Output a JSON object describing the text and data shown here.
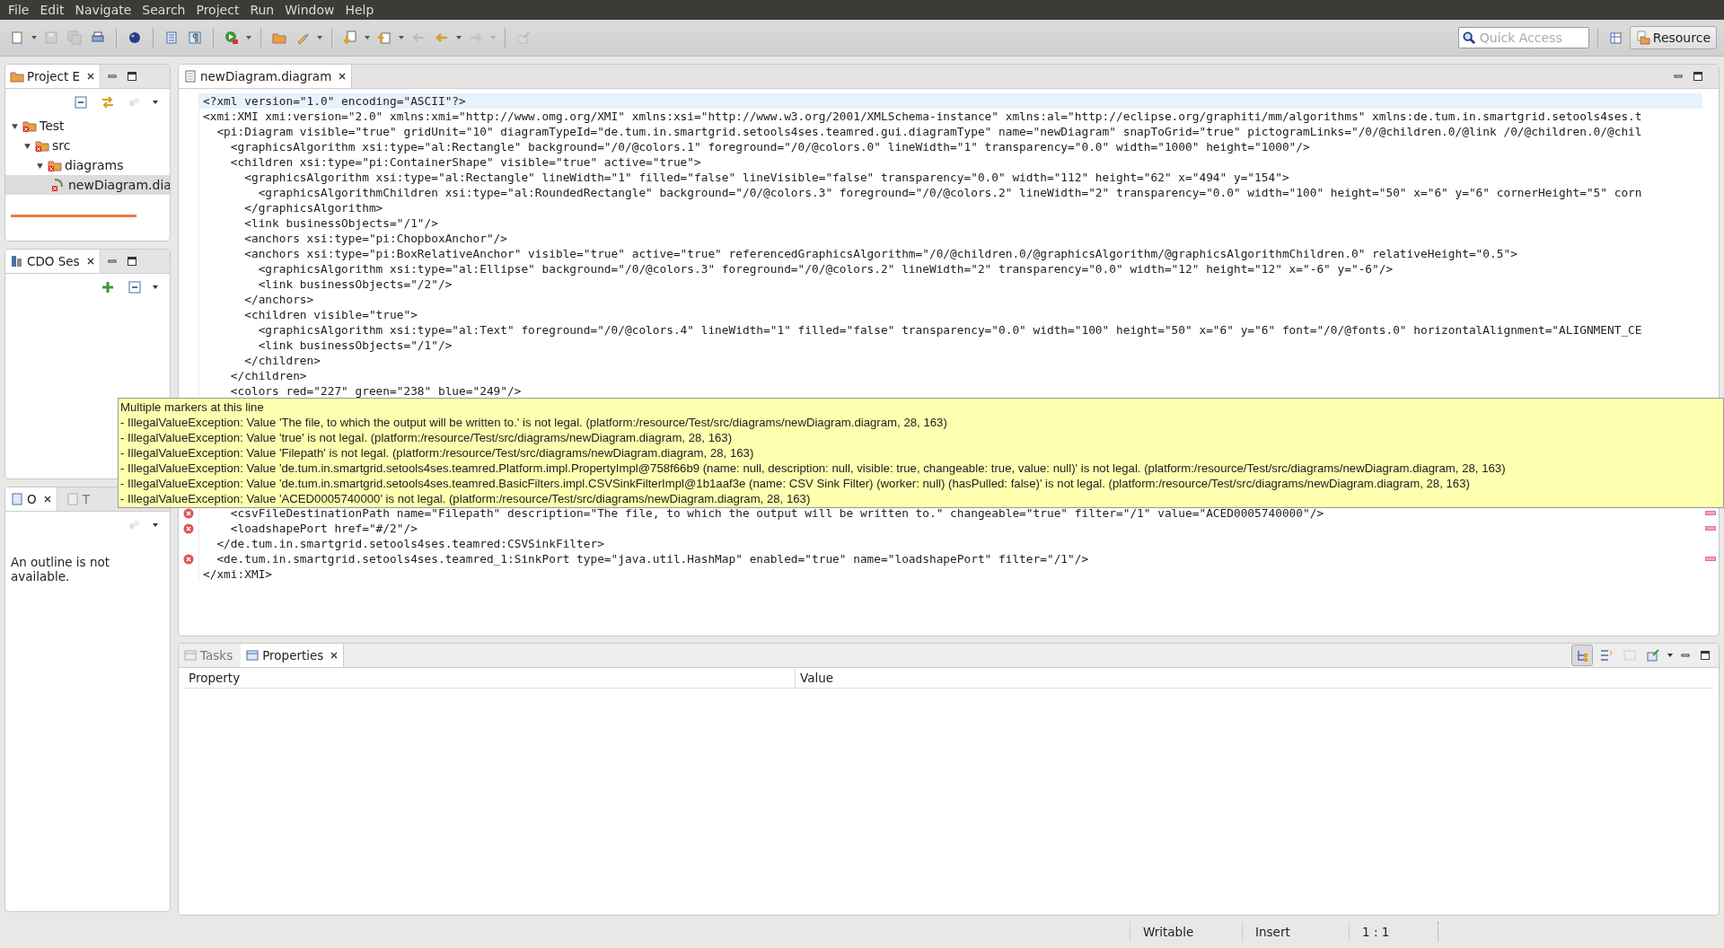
{
  "menu": [
    "File",
    "Edit",
    "Navigate",
    "Search",
    "Project",
    "Run",
    "Window",
    "Help"
  ],
  "quick_access": {
    "placeholder": "Quick Access"
  },
  "perspective": {
    "label": "Resource",
    "selected": true
  },
  "project_explorer": {
    "tab": "Project E",
    "tree": [
      {
        "label": "Test",
        "kind": "project",
        "expanded": true,
        "selected": false,
        "children": [
          {
            "label": "src",
            "kind": "folder",
            "expanded": true,
            "selected": false,
            "children": [
              {
                "label": "diagrams",
                "kind": "folder",
                "expanded": true,
                "selected": false,
                "children": [
                  {
                    "label": "newDiagram.dia",
                    "kind": "file",
                    "selected": true
                  }
                ]
              }
            ]
          }
        ]
      }
    ]
  },
  "cdo_sessions": {
    "tab": "CDO Ses"
  },
  "outline": {
    "tabs": [
      {
        "label": "O",
        "selected": true
      },
      {
        "label": "T",
        "selected": false
      }
    ],
    "message": "An outline is not available."
  },
  "editor": {
    "tab": "newDiagram.diagram",
    "lines_top": [
      {
        "text": "<?xml version=\"1.0\" encoding=\"ASCII\"?>",
        "current": true,
        "error": false
      },
      {
        "text": "<xmi:XMI xmi:version=\"2.0\" xmlns:xmi=\"http://www.omg.org/XMI\" xmlns:xsi=\"http://www.w3.org/2001/XMLSchema-instance\" xmlns:al=\"http://eclipse.org/graphiti/mm/algorithms\" xmlns:de.tum.in.smartgrid.setools4ses.t",
        "current": false,
        "error": false
      },
      {
        "text": "  <pi:Diagram visible=\"true\" gridUnit=\"10\" diagramTypeId=\"de.tum.in.smartgrid.setools4ses.teamred.gui.diagramType\" name=\"newDiagram\" snapToGrid=\"true\" pictogramLinks=\"/0/@children.0/@link /0/@children.0/@chil",
        "current": false,
        "error": false
      },
      {
        "text": "    <graphicsAlgorithm xsi:type=\"al:Rectangle\" background=\"/0/@colors.1\" foreground=\"/0/@colors.0\" lineWidth=\"1\" transparency=\"0.0\" width=\"1000\" height=\"1000\"/>",
        "current": false,
        "error": false
      },
      {
        "text": "    <children xsi:type=\"pi:ContainerShape\" visible=\"true\" active=\"true\">",
        "current": false,
        "error": false
      },
      {
        "text": "      <graphicsAlgorithm xsi:type=\"al:Rectangle\" lineWidth=\"1\" filled=\"false\" lineVisible=\"false\" transparency=\"0.0\" width=\"112\" height=\"62\" x=\"494\" y=\"154\">",
        "current": false,
        "error": false
      },
      {
        "text": "        <graphicsAlgorithmChildren xsi:type=\"al:RoundedRectangle\" background=\"/0/@colors.3\" foreground=\"/0/@colors.2\" lineWidth=\"2\" transparency=\"0.0\" width=\"100\" height=\"50\" x=\"6\" y=\"6\" cornerHeight=\"5\" corn",
        "current": false,
        "error": false
      },
      {
        "text": "      </graphicsAlgorithm>",
        "current": false,
        "error": false
      },
      {
        "text": "      <link businessObjects=\"/1\"/>",
        "current": false,
        "error": false
      },
      {
        "text": "      <anchors xsi:type=\"pi:ChopboxAnchor\"/>",
        "current": false,
        "error": false
      },
      {
        "text": "      <anchors xsi:type=\"pi:BoxRelativeAnchor\" visible=\"true\" active=\"true\" referencedGraphicsAlgorithm=\"/0/@children.0/@graphicsAlgorithm/@graphicsAlgorithmChildren.0\" relativeHeight=\"0.5\">",
        "current": false,
        "error": false
      },
      {
        "text": "        <graphicsAlgorithm xsi:type=\"al:Ellipse\" background=\"/0/@colors.3\" foreground=\"/0/@colors.2\" lineWidth=\"2\" transparency=\"0.0\" width=\"12\" height=\"12\" x=\"-6\" y=\"-6\"/>",
        "current": false,
        "error": false
      },
      {
        "text": "        <link businessObjects=\"/2\"/>",
        "current": false,
        "error": false
      },
      {
        "text": "      </anchors>",
        "current": false,
        "error": false
      },
      {
        "text": "      <children visible=\"true\">",
        "current": false,
        "error": false
      },
      {
        "text": "        <graphicsAlgorithm xsi:type=\"al:Text\" foreground=\"/0/@colors.4\" lineWidth=\"1\" filled=\"false\" transparency=\"0.0\" width=\"100\" height=\"50\" x=\"6\" y=\"6\" font=\"/0/@fonts.0\" horizontalAlignment=\"ALIGNMENT_CE",
        "current": false,
        "error": false
      },
      {
        "text": "        <link businessObjects=\"/1\"/>",
        "current": false,
        "error": false
      },
      {
        "text": "      </children>",
        "current": false,
        "error": false
      },
      {
        "text": "    </children>",
        "current": false,
        "error": false
      },
      {
        "text": "    <colors red=\"227\" green=\"238\" blue=\"249\"/>",
        "current": false,
        "error": false
      }
    ],
    "lines_bottom": [
      {
        "text": "    <csvFileDestinationPath name=\"Filepath\" description=\"The file, to which the output will be written to.\" changeable=\"true\" filter=\"/1\" value=\"ACED0005740000\"/>",
        "current": false,
        "error": true
      },
      {
        "text": "    <loadshapePort href=\"#/2\"/>",
        "current": false,
        "error": true
      },
      {
        "text": "  </de.tum.in.smartgrid.setools4ses.teamred:CSVSinkFilter>",
        "current": false,
        "error": false
      },
      {
        "text": "  <de.tum.in.smartgrid.setools4ses.teamred_1:SinkPort type=\"java.util.HashMap\" enabled=\"true\" name=\"loadshapePort\" filter=\"/1\"/>",
        "current": false,
        "error": true
      },
      {
        "text": "</xmi:XMI>",
        "current": false,
        "error": false
      }
    ],
    "tooltip": {
      "title": "Multiple markers at this line",
      "items": [
        "- IllegalValueException: Value 'The file, to which the output will be written to.' is not legal. (platform:/resource/Test/src/diagrams/newDiagram.diagram, 28, 163)",
        "- IllegalValueException: Value 'true' is not legal. (platform:/resource/Test/src/diagrams/newDiagram.diagram, 28, 163)",
        "- IllegalValueException: Value 'Filepath' is not legal. (platform:/resource/Test/src/diagrams/newDiagram.diagram, 28, 163)",
        "- IllegalValueException: Value 'de.tum.in.smartgrid.setools4ses.teamred.Platform.impl.PropertyImpl@758f66b9 (name: null, description: null, visible: true, changeable: true, value: null)' is not legal. (platform:/resource/Test/src/diagrams/newDiagram.diagram, 28, 163)",
        "- IllegalValueException: Value 'de.tum.in.smartgrid.setools4ses.teamred.BasicFilters.impl.CSVSinkFilterImpl@1b1aaf3e (name: CSV Sink Filter) (worker: null) (hasPulled: false)' is not legal. (platform:/resource/Test/src/diagrams/newDiagram.diagram, 28, 163)",
        "- IllegalValueException: Value 'ACED0005740000' is not legal. (platform:/resource/Test/src/diagrams/newDiagram.diagram, 28, 163)"
      ]
    }
  },
  "bottom_panel": {
    "tabs": [
      {
        "label": "Tasks",
        "selected": false
      },
      {
        "label": "Properties",
        "selected": true
      }
    ],
    "columns": [
      "Property",
      "Value"
    ]
  },
  "status_bar": [
    "Writable",
    "Insert",
    "1 : 1"
  ]
}
